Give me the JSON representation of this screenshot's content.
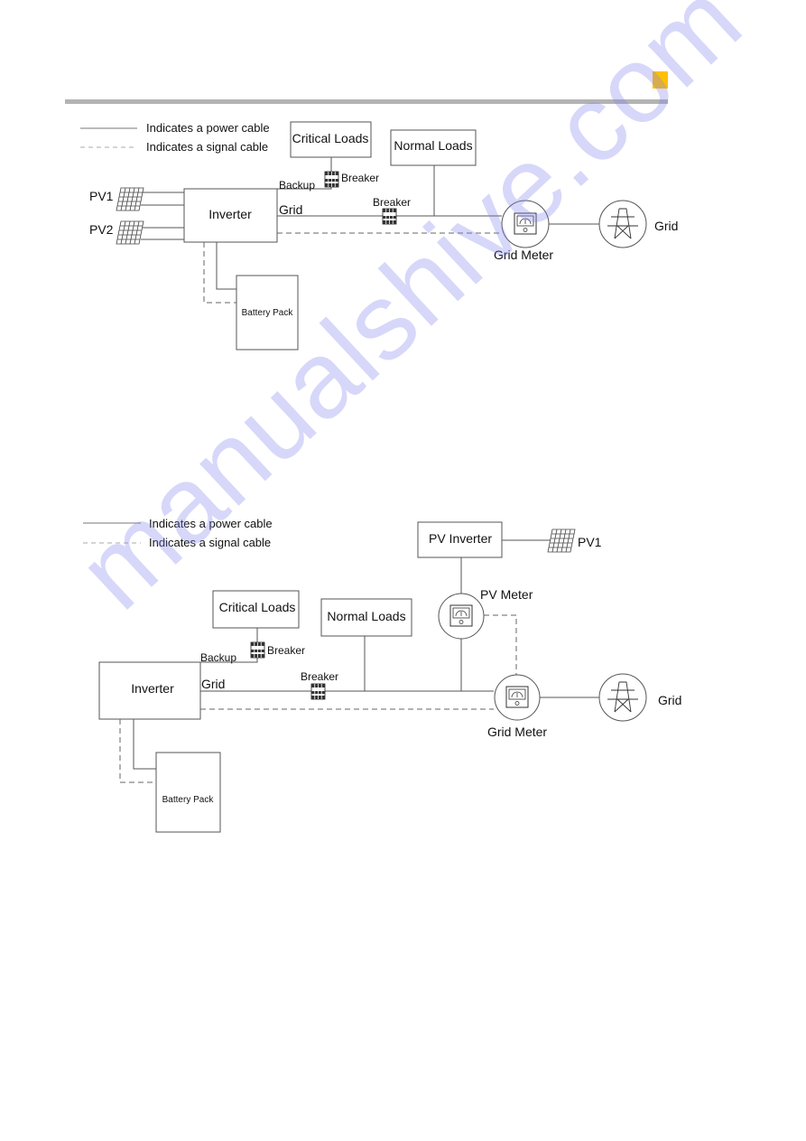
{
  "page": {
    "accent_color": "#ffc000",
    "rule_color": "#b3b3b3",
    "watermark_text": "manualshive.com",
    "watermark_color": "#c8c8f8"
  },
  "diagram1": {
    "legend": {
      "power": "Indicates a power cable",
      "signal": "Indicates a signal cable"
    },
    "pv1": "PV1",
    "pv2": "PV2",
    "inverter": "Inverter",
    "backup_label": "Backup",
    "grid_label": "Grid",
    "critical_loads": "Critical Loads",
    "normal_loads": "Normal Loads",
    "breaker_backup": "Breaker",
    "breaker_grid": "Breaker",
    "grid_meter": "Grid Meter",
    "grid": "Grid",
    "battery_pack": "Battery Pack",
    "icons": [
      "pv-panel-icon",
      "breaker-icon",
      "meter-icon",
      "grid-tower-icon"
    ]
  },
  "diagram2": {
    "legend": {
      "power": "Indicates a power cable",
      "signal": "Indicates a signal cable"
    },
    "pv_inverter": "PV Inverter",
    "pv1": "PV1",
    "pv_meter": "PV Meter",
    "inverter": "Inverter",
    "backup_label": "Backup",
    "grid_label": "Grid",
    "critical_loads": "Critical Loads",
    "normal_loads": "Normal Loads",
    "breaker_backup": "Breaker",
    "breaker_grid": "Breaker",
    "grid_meter": "Grid Meter",
    "grid": "Grid",
    "battery_pack": "Battery Pack",
    "icons": [
      "pv-panel-icon",
      "breaker-icon",
      "meter-icon",
      "grid-tower-icon"
    ]
  }
}
